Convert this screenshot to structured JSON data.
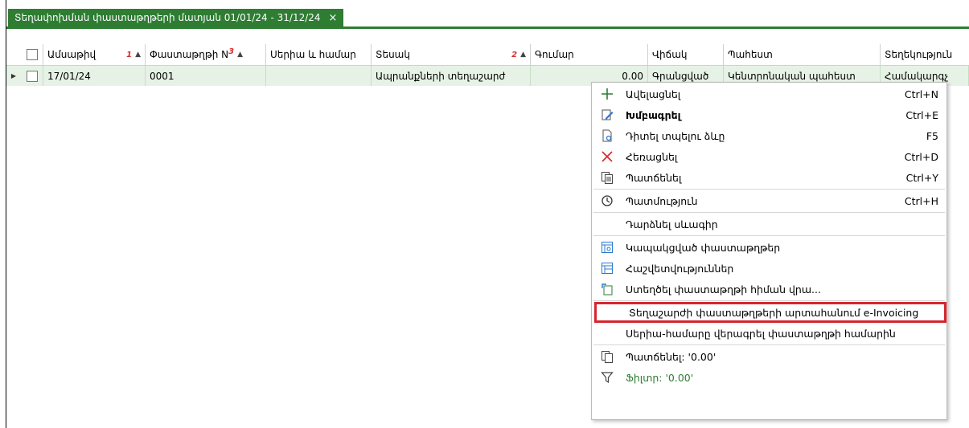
{
  "tab": {
    "title": "Տեղափոխման փաստաթղթերի մատյան 01/01/24 - 31/12/24",
    "close": "×"
  },
  "columns": {
    "date": "Ամսաթիվ",
    "date_sort": "1",
    "doc_no": "Փաստաթղթի N",
    "doc_no_sort": "3",
    "series": "Սերիա և համար",
    "type": "Տեսակ",
    "type_sort": "2",
    "amount": "Գումար",
    "status": "Վիճակ",
    "warehouse": "Պահեստ",
    "info": "Տեղեկություն"
  },
  "rows": [
    {
      "date": "17/01/24",
      "doc_no": "0001",
      "series": "",
      "type": "Ապրանքների տեղաշարժ",
      "amount": "0.00",
      "status": "Գրանցված",
      "warehouse": "Կենտրոնական պահեստ",
      "info": "Համակարգչ"
    }
  ],
  "context_menu": {
    "items": [
      {
        "label": "Ավելացնել",
        "shortcut": "Ctrl+N",
        "icon": "plus-icon"
      },
      {
        "label": "Խմբագրել",
        "shortcut": "Ctrl+E",
        "icon": "edit-icon"
      },
      {
        "label": "Դիտել տպելու ձևը",
        "shortcut": "F5",
        "icon": "preview-icon"
      },
      {
        "label": "Հեռացնել",
        "shortcut": "Ctrl+D",
        "icon": "delete-icon"
      },
      {
        "label": "Պատճենել",
        "shortcut": "Ctrl+Y",
        "icon": "copy-icon"
      },
      {
        "label": "Պատմություն",
        "shortcut": "Ctrl+H",
        "icon": "history-icon"
      },
      {
        "label": "Դարձնել սևագիր",
        "shortcut": "",
        "icon": ""
      },
      {
        "label": "Կապակցված փաստաթղթեր",
        "shortcut": "",
        "icon": "linked-docs-icon"
      },
      {
        "label": "Հաշվետվություններ",
        "shortcut": "",
        "icon": "reports-icon"
      },
      {
        "label": "Ստեղծել փաստաթղթի հիման վրա...",
        "shortcut": "",
        "icon": "create-based-icon"
      },
      {
        "label": "Տեղաշարժի փաստաթղթերի արտահանում e-Invoicing",
        "shortcut": "",
        "icon": ""
      },
      {
        "label": "Սերիա-համարը վերագրել փաստաթղթի համարին",
        "shortcut": "",
        "icon": ""
      },
      {
        "label": "Պատճենել: '0.00'",
        "shortcut": "",
        "icon": "copy-value-icon"
      },
      {
        "label": "Ֆիլտր: '0.00'",
        "shortcut": "",
        "icon": "filter-icon"
      }
    ]
  },
  "colors": {
    "accent": "#2e7d32",
    "row_selected": "#e6f2e6",
    "highlight": "#d6262d"
  }
}
